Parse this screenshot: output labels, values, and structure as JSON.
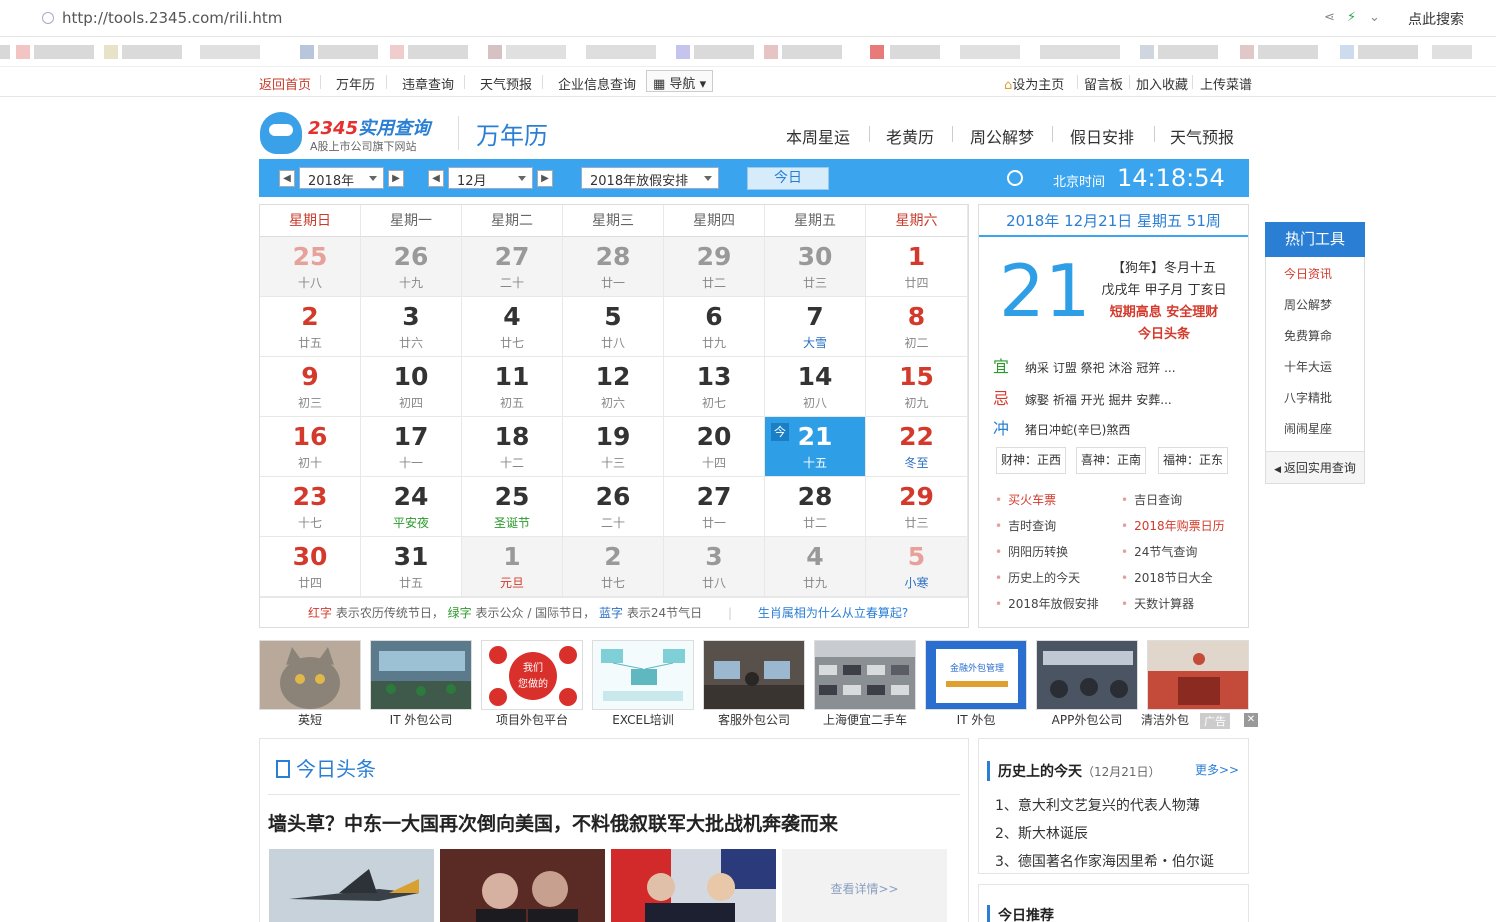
{
  "browser": {
    "url": "http://tools.2345.com/rili.htm",
    "search_label": "点此搜索"
  },
  "topnav": {
    "home": "返回首页",
    "wannianli": "万年历",
    "weizhang": "违章查询",
    "weather": "天气预报",
    "company": "企业信息查询",
    "nav": "导航",
    "set_home": "设为主页",
    "message": "留言板",
    "favorite": "加入收藏",
    "upload": "上传菜谱"
  },
  "header": {
    "brand_num": "2345",
    "brand_text": "实用查询",
    "brand_sub": "A股上市公司旗下网站",
    "page_title": "万年历",
    "links": [
      "本周星运",
      "老黄历",
      "周公解梦",
      "假日安排",
      "天气预报"
    ]
  },
  "toolbar": {
    "year": "2018年",
    "month": "12月",
    "holiday": "2018年放假安排",
    "today": "今日",
    "bj_label": "北京时间",
    "bj_time": "14:18:54"
  },
  "calendar": {
    "weekdays": [
      "星期日",
      "星期一",
      "星期二",
      "星期三",
      "星期四",
      "星期五",
      "星期六"
    ],
    "weeks": [
      [
        {
          "d": "25",
          "l": "十八",
          "o": true
        },
        {
          "d": "26",
          "l": "十九",
          "o": true
        },
        {
          "d": "27",
          "l": "二十",
          "o": true
        },
        {
          "d": "28",
          "l": "廿一",
          "o": true
        },
        {
          "d": "29",
          "l": "廿二",
          "o": true
        },
        {
          "d": "30",
          "l": "廿三",
          "o": true
        },
        {
          "d": "1",
          "l": "廿四"
        }
      ],
      [
        {
          "d": "2",
          "l": "廿五"
        },
        {
          "d": "3",
          "l": "廿六"
        },
        {
          "d": "4",
          "l": "廿七"
        },
        {
          "d": "5",
          "l": "廿八"
        },
        {
          "d": "6",
          "l": "廿九"
        },
        {
          "d": "7",
          "l": "大雪",
          "c": "blue"
        },
        {
          "d": "8",
          "l": "初二"
        }
      ],
      [
        {
          "d": "9",
          "l": "初三"
        },
        {
          "d": "10",
          "l": "初四"
        },
        {
          "d": "11",
          "l": "初五"
        },
        {
          "d": "12",
          "l": "初六"
        },
        {
          "d": "13",
          "l": "初七"
        },
        {
          "d": "14",
          "l": "初八"
        },
        {
          "d": "15",
          "l": "初九"
        }
      ],
      [
        {
          "d": "16",
          "l": "初十"
        },
        {
          "d": "17",
          "l": "十一"
        },
        {
          "d": "18",
          "l": "十二"
        },
        {
          "d": "19",
          "l": "十三"
        },
        {
          "d": "20",
          "l": "十四"
        },
        {
          "d": "21",
          "l": "十五",
          "t": true
        },
        {
          "d": "22",
          "l": "冬至",
          "c": "blue"
        }
      ],
      [
        {
          "d": "23",
          "l": "十七"
        },
        {
          "d": "24",
          "l": "平安夜",
          "c": "green"
        },
        {
          "d": "25",
          "l": "圣诞节",
          "c": "green"
        },
        {
          "d": "26",
          "l": "二十"
        },
        {
          "d": "27",
          "l": "廿一"
        },
        {
          "d": "28",
          "l": "廿二"
        },
        {
          "d": "29",
          "l": "廿三"
        }
      ],
      [
        {
          "d": "30",
          "l": "廿四"
        },
        {
          "d": "31",
          "l": "廿五"
        },
        {
          "d": "1",
          "l": "元旦",
          "o": true,
          "c": "red"
        },
        {
          "d": "2",
          "l": "廿七",
          "o": true
        },
        {
          "d": "3",
          "l": "廿八",
          "o": true
        },
        {
          "d": "4",
          "l": "廿九",
          "o": true
        },
        {
          "d": "5",
          "l": "小寒",
          "o": true,
          "c": "blue"
        }
      ]
    ],
    "today_mark": "今",
    "legend": {
      "red": "红字",
      "red_desc": " 表示农历传统节日，",
      "green": "绿字",
      "green_desc": " 表示公众 / 国际节日，",
      "blue": "蓝字",
      "blue_desc": " 表示24节气日",
      "question": "生肖属相为什么从立春算起?"
    }
  },
  "detail": {
    "head": "2018年 12月21日 星期五 51周",
    "big_day": "21",
    "lunar": "【狗年】冬月十五",
    "ganzhi": "戊戌年  甲子月  丁亥日",
    "promo": "短期高息 安全理财",
    "headline_link": "今日头条",
    "yi_key": "宜",
    "yi": "纳采  订盟  祭祀  沐浴  冠笄  ...",
    "ji_key": "忌",
    "ji": "嫁娶 祈福 开光 掘井 安葬...",
    "chong_key": "冲",
    "chong": "猪日冲蛇(辛巳)煞西",
    "caishen": "财神：正西",
    "xishen": "喜神：正南",
    "fushen": "福神：正东",
    "links": [
      {
        "t": "买火车票",
        "red": true
      },
      {
        "t": "吉日查询"
      },
      {
        "t": "吉时查询"
      },
      {
        "t": "2018年购票日历",
        "red": true
      },
      {
        "t": "阴阳历转换"
      },
      {
        "t": "24节气查询"
      },
      {
        "t": "历史上的今天"
      },
      {
        "t": "2018节日大全"
      },
      {
        "t": "2018年放假安排"
      },
      {
        "t": "天数计算器"
      }
    ]
  },
  "hot": {
    "head": "热门工具",
    "items": [
      "今日资讯",
      "周公解梦",
      "免费算命",
      "十年大运",
      "八字精批",
      "闹闹星座"
    ],
    "back": "返回实用查询"
  },
  "ads": {
    "captions": [
      "英短",
      "IT 外包公司",
      "项目外包平台",
      "EXCEL培训",
      "客服外包公司",
      "上海便宜二手车",
      "IT 外包",
      "APP外包公司",
      "清洁外包"
    ],
    "tag": "广告",
    "close": "✕",
    "wk_brand_a": "我们",
    "wk_brand_b": "您做的",
    "finance": "金融外包管理"
  },
  "news": {
    "title": "今日头条",
    "headline": "墙头草？中东一大国再次倒向美国，不料俄叙联军大批战机奔袭而来",
    "more": "查看详情>>"
  },
  "history": {
    "title": "历史上的今天",
    "date": "（12月21日）",
    "more": "更多>>",
    "items": [
      "1、意大利文艺复兴的代表人物薄",
      "2、斯大林诞辰",
      "3、德国著名作家海因里希・伯尔诞"
    ]
  },
  "recommend": {
    "title": "今日推荐"
  },
  "colors": {
    "accent": "#3aa5ee",
    "today": "#2e9fe6",
    "holiday_red": "#d33a2c",
    "festival_green": "#2a9a2a",
    "solar_blue": "#2a6fc4"
  }
}
